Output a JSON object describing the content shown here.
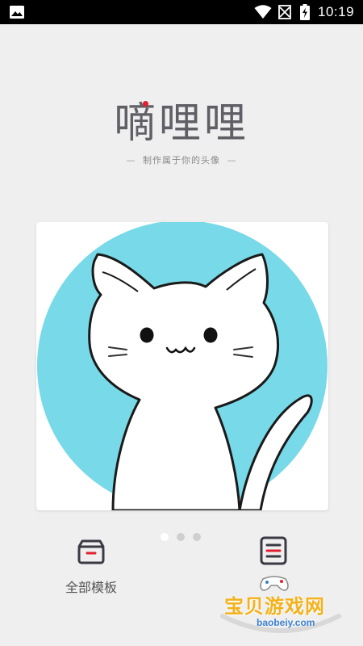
{
  "status_bar": {
    "time": "10:19",
    "icons": [
      "image-icon",
      "wifi-icon",
      "no-sim-icon",
      "battery-charging-icon"
    ]
  },
  "header": {
    "logo_text": "嘀哩哩",
    "tagline": "制作属于你的头像",
    "tagline_dash": "—"
  },
  "carousel": {
    "image": "cat-avatar",
    "page_count": 3,
    "active_index": 0,
    "accent_color": "#78d9e8"
  },
  "bottom_nav": {
    "left": {
      "label": "全部模板",
      "icon": "box-icon"
    },
    "right": {
      "label": "",
      "icon": "list-icon"
    }
  },
  "watermark": {
    "text": "宝贝游戏网",
    "url": "baobeiy.com"
  },
  "colors": {
    "background": "#efefef",
    "brand_red": "#e2202e",
    "logo_gray": "#5f5f66",
    "icon_dark": "#3a3a44"
  }
}
